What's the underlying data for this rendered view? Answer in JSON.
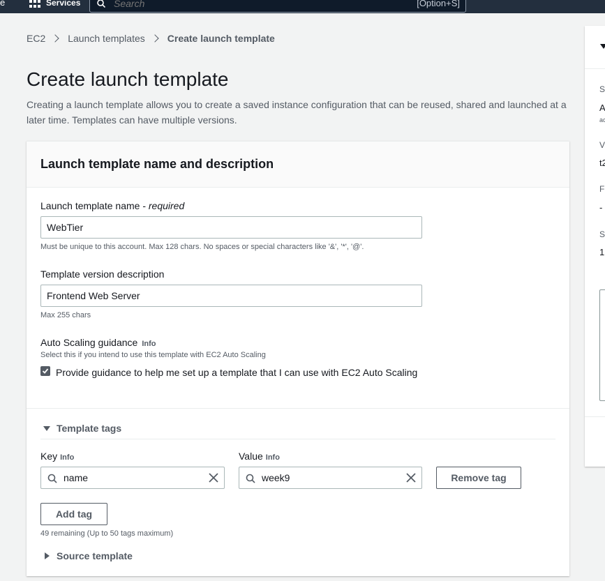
{
  "topbar": {
    "logo_fragment": "e",
    "services_label": "Services",
    "search_placeholder": "Search",
    "search_shortcut": "[Option+S]"
  },
  "breadcrumb": {
    "items": [
      "EC2",
      "Launch templates"
    ],
    "current": "Create launch template"
  },
  "page": {
    "title": "Create launch template",
    "description": "Creating a launch template allows you to create a saved instance configuration that can be reused, shared and launched at a later time. Templates can have multiple versions."
  },
  "panel": {
    "title": "Launch template name and description",
    "name_label": "Launch template name - ",
    "name_required": "required",
    "name_value": "WebTier",
    "name_hint": "Must be unique to this account. Max 128 chars. No spaces or special characters like '&', '*', '@'.",
    "desc_label": "Template version description",
    "desc_value": "Frontend Web Server",
    "desc_hint": "Max 255 chars",
    "asg_label": "Auto Scaling guidance",
    "asg_info": "Info",
    "asg_hint": "Select this if you intend to use this template with EC2 Auto Scaling",
    "asg_checkbox_label": "Provide guidance to help me set up a template that I can use with EC2 Auto Scaling",
    "asg_checked": true
  },
  "tags": {
    "section_label": "Template tags",
    "key_label": "Key",
    "value_label": "Value",
    "info": "Info",
    "rows": [
      {
        "key": "name",
        "value": "week9"
      }
    ],
    "remove_label": "Remove tag",
    "add_label": "Add tag",
    "remaining": "49 remaining (Up to 50 tags maximum)"
  },
  "source_template": {
    "label": "Source template"
  },
  "summary_panel": {
    "fragments": [
      "S",
      "A",
      "ac",
      "V",
      "t2",
      "F",
      "-",
      "S",
      "1"
    ]
  }
}
